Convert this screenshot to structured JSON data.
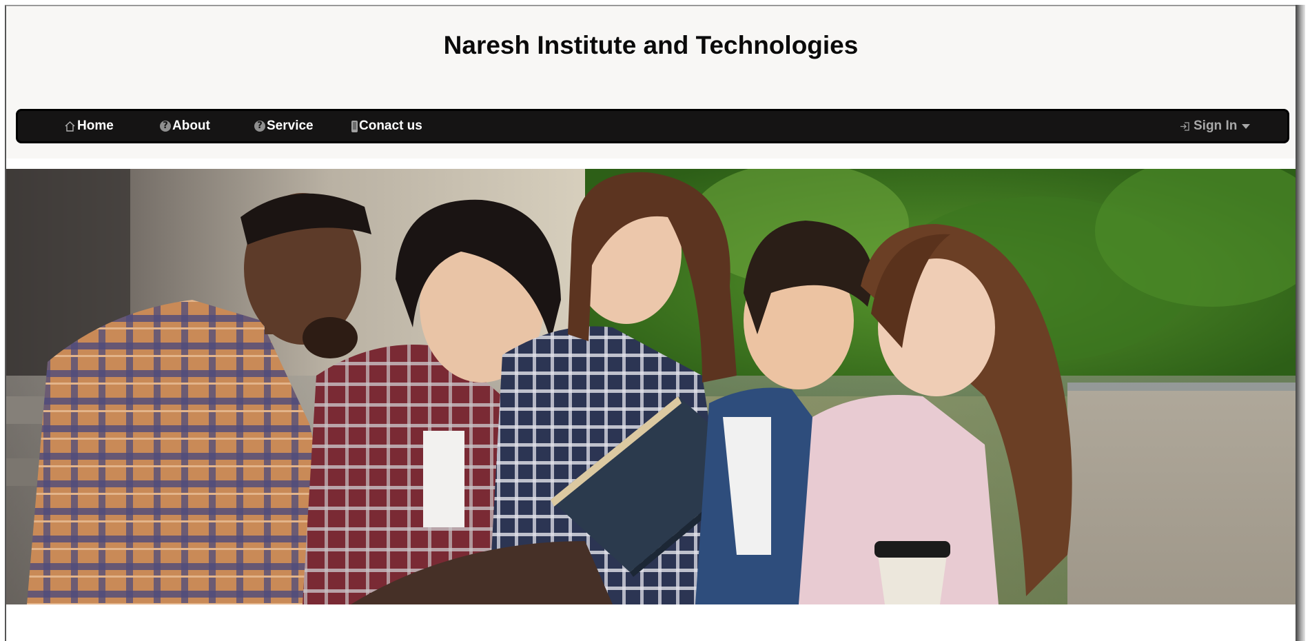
{
  "header": {
    "title": "Naresh Institute and Technologies"
  },
  "nav": {
    "items": [
      {
        "label": "Home",
        "icon": "home-icon"
      },
      {
        "label": "About",
        "icon": "question-icon"
      },
      {
        "label": "Service",
        "icon": "question-icon"
      },
      {
        "label": "Conact us",
        "icon": "phone-icon"
      }
    ],
    "signin": {
      "label": "Sign In",
      "icon": "sign-in-icon",
      "caret": "caret-down-icon"
    }
  },
  "hero": {
    "image": "group-of-students-reading-book-photo"
  },
  "colors": {
    "header_bg": "#f8f7f5",
    "nav_bg": "#151414",
    "nav_text": "#ffffff",
    "signin_text": "#a8a8a8"
  }
}
